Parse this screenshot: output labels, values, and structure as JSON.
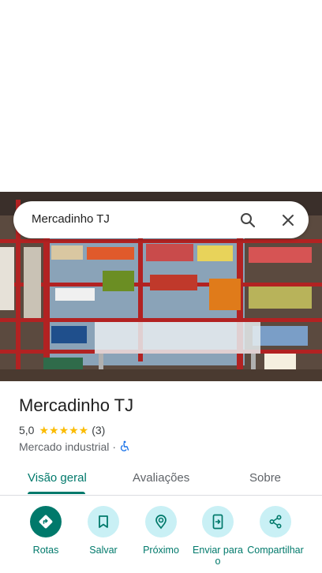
{
  "search": {
    "query": "Mercadinho TJ"
  },
  "place": {
    "name": "Mercadinho TJ",
    "rating": "5,0",
    "stars": "★★★★★",
    "review_count": "(3)",
    "category": "Mercado industrial",
    "separator": "·"
  },
  "tabs": [
    {
      "label": "Visão geral",
      "active": true
    },
    {
      "label": "Avaliações",
      "active": false
    },
    {
      "label": "Sobre",
      "active": false
    }
  ],
  "actions": [
    {
      "label": "Rotas",
      "icon": "directions-icon"
    },
    {
      "label": "Salvar",
      "icon": "bookmark-icon"
    },
    {
      "label": "Próximo",
      "icon": "nearby-icon"
    },
    {
      "label": "Enviar para o",
      "icon": "send-to-phone-icon"
    },
    {
      "label": "Compartilhar",
      "icon": "share-icon"
    }
  ],
  "colors": {
    "accent": "#00796b",
    "action_bg": "#c9f0f5",
    "star": "#fbbc04"
  }
}
